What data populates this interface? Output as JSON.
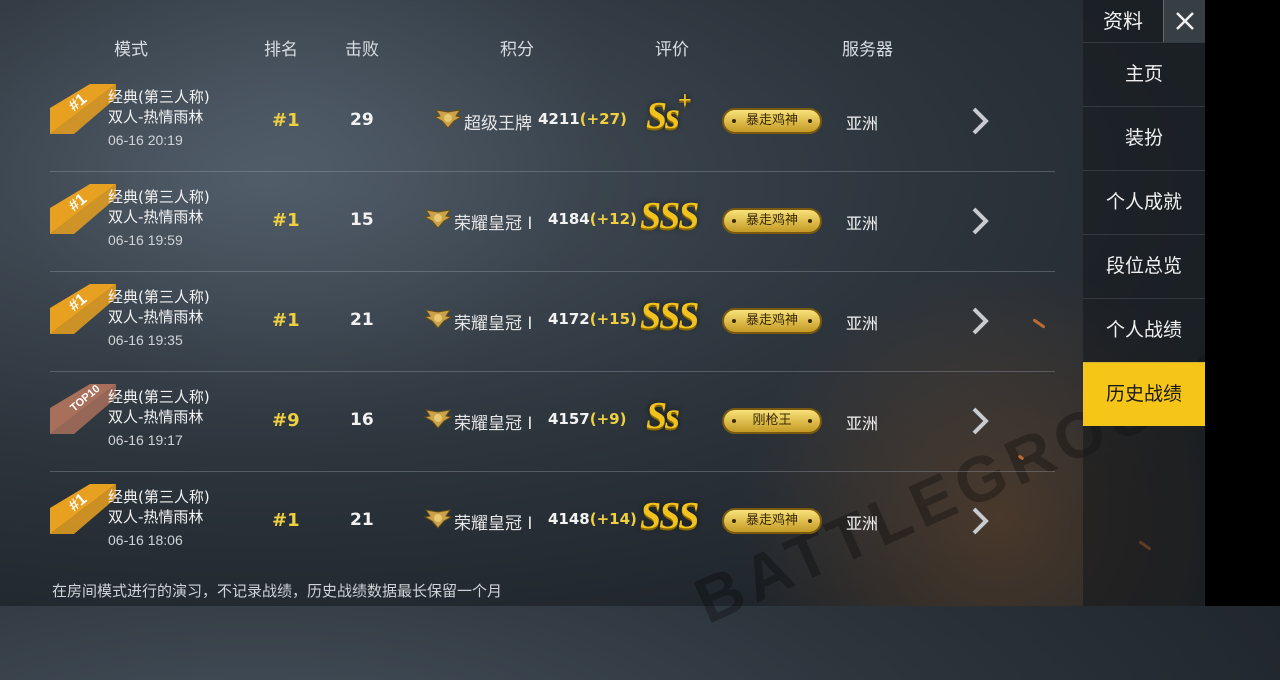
{
  "header": {
    "mode": "模式",
    "rank": "排名",
    "kills": "击败",
    "score": "积分",
    "rating": "评价",
    "server": "服务器"
  },
  "rows": [
    {
      "badge": "#1",
      "badge_type": "first",
      "mode_line1": "经典(第三人称)",
      "mode_line2": "双人-热情雨林",
      "date": "06-16 20:19",
      "rank": "#1",
      "kills": "29",
      "tier": "超级王牌",
      "score": "4211",
      "delta": "(+27)",
      "grade": "Ss",
      "grade_plus": "+",
      "title": "暴走鸡神",
      "server": "亚洲"
    },
    {
      "badge": "#1",
      "badge_type": "first",
      "mode_line1": "经典(第三人称)",
      "mode_line2": "双人-热情雨林",
      "date": "06-16 19:59",
      "rank": "#1",
      "kills": "15",
      "tier": "荣耀皇冠 I",
      "score": "4184",
      "delta": "(+12)",
      "grade": "SSS",
      "grade_plus": "",
      "title": "暴走鸡神",
      "server": "亚洲"
    },
    {
      "badge": "#1",
      "badge_type": "first",
      "mode_line1": "经典(第三人称)",
      "mode_line2": "双人-热情雨林",
      "date": "06-16 19:35",
      "rank": "#1",
      "kills": "21",
      "tier": "荣耀皇冠 I",
      "score": "4172",
      "delta": "(+15)",
      "grade": "SSS",
      "grade_plus": "",
      "title": "暴走鸡神",
      "server": "亚洲"
    },
    {
      "badge": "TOP10",
      "badge_type": "top10",
      "mode_line1": "经典(第三人称)",
      "mode_line2": "双人-热情雨林",
      "date": "06-16 19:17",
      "rank": "#9",
      "kills": "16",
      "tier": "荣耀皇冠 I",
      "score": "4157",
      "delta": "(+9)",
      "grade": "Ss",
      "grade_plus": "",
      "title": "刚枪王",
      "server": "亚洲"
    },
    {
      "badge": "#1",
      "badge_type": "first",
      "mode_line1": "经典(第三人称)",
      "mode_line2": "双人-热情雨林",
      "date": "06-16 18:06",
      "rank": "#1",
      "kills": "21",
      "tier": "荣耀皇冠 I",
      "score": "4148",
      "delta": "(+14)",
      "grade": "SSS",
      "grade_plus": "",
      "title": "暴走鸡神",
      "server": "亚洲"
    }
  ],
  "note": "在房间模式进行的演习，不记录战绩，历史战绩数据最长保留一个月",
  "sidebar": {
    "title": "资料",
    "close_icon": "close-icon",
    "items": [
      {
        "label": "主页"
      },
      {
        "label": "装扮"
      },
      {
        "label": "个人成就"
      },
      {
        "label": "段位总览"
      },
      {
        "label": "个人战绩"
      },
      {
        "label": "历史战绩",
        "active": true
      }
    ]
  },
  "watermark": "BATTLEGROUNDS",
  "colors": {
    "accent": "#f5c518",
    "gold": "#f0d040",
    "badge_first": "#e8a020",
    "badge_top10": "#a8705a"
  }
}
